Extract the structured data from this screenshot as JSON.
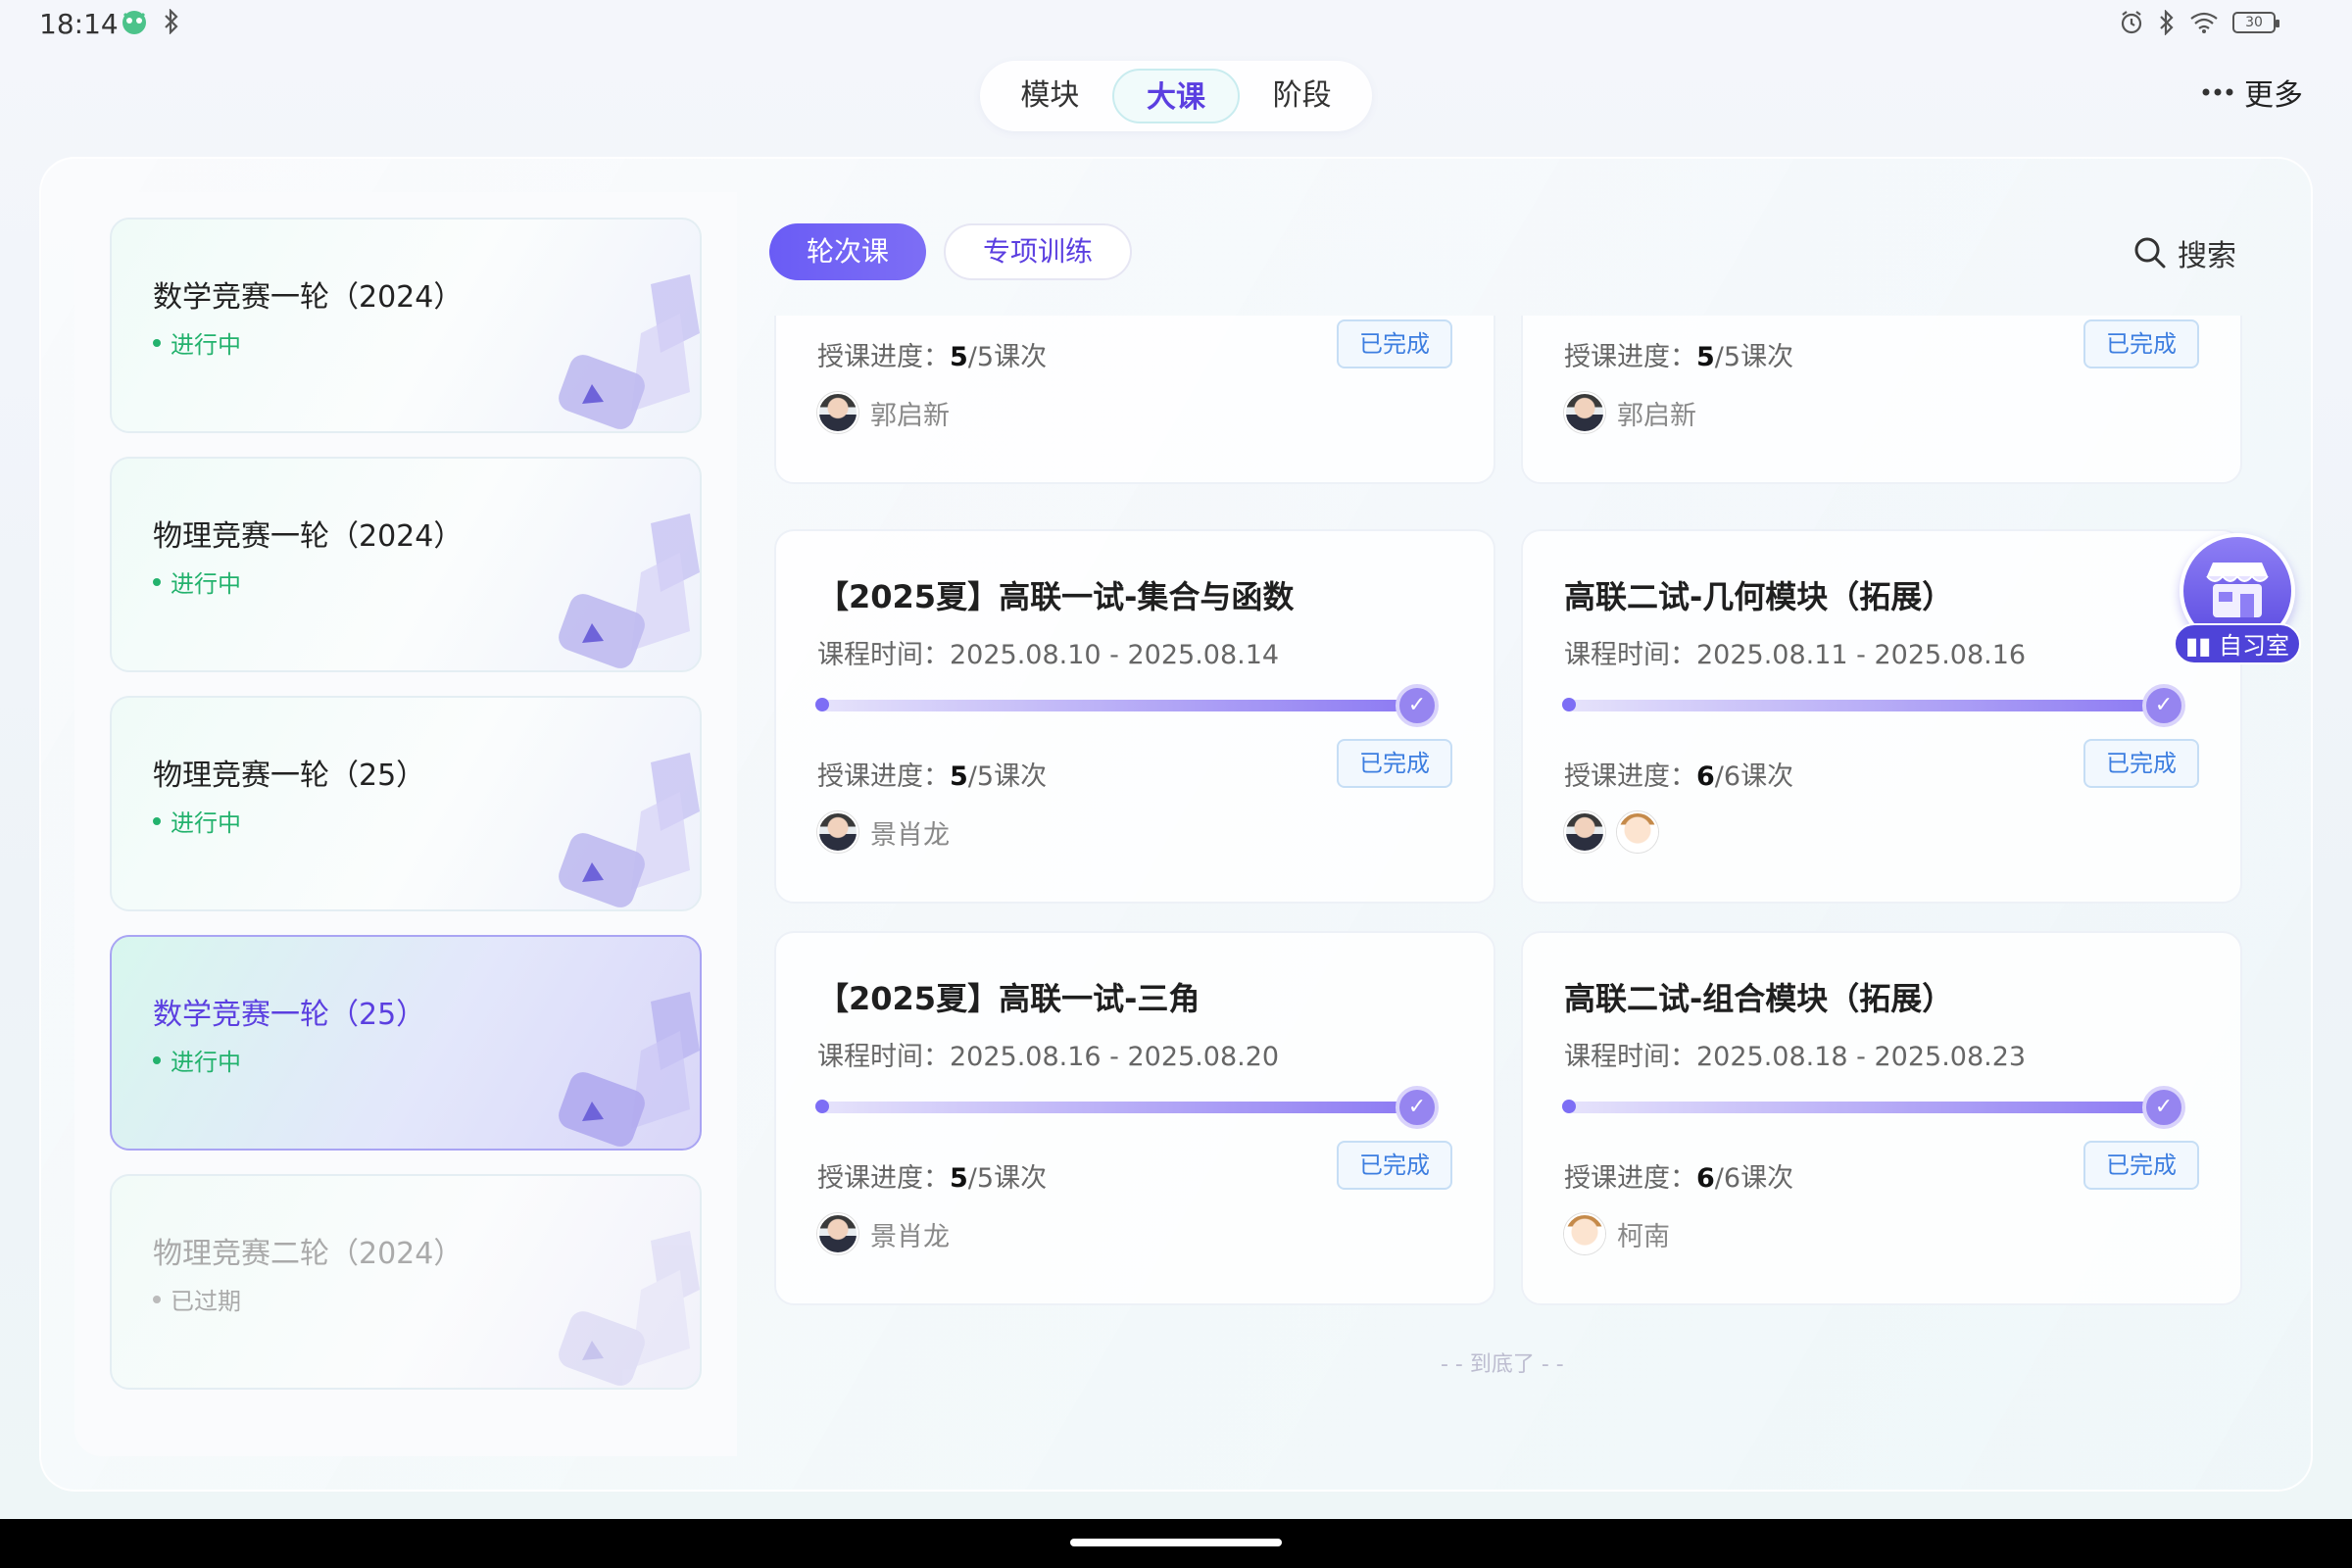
{
  "status_bar": {
    "time": "18:14",
    "battery": "30"
  },
  "top_tabs": [
    {
      "label": "模块",
      "active": false
    },
    {
      "label": "大课",
      "active": true
    },
    {
      "label": "阶段",
      "active": false
    }
  ],
  "more_label": "更多",
  "courses": [
    {
      "title": "数学竞赛一轮（2024）",
      "status": "进行中"
    },
    {
      "title": "物理竞赛一轮（2024）",
      "status": "进行中"
    },
    {
      "title": "物理竞赛一轮（25）",
      "status": "进行中"
    },
    {
      "title": "数学竞赛一轮（25）",
      "status": "进行中",
      "active": true
    },
    {
      "title": "物理竞赛二轮（2024）",
      "status": "已过期",
      "expired": true
    }
  ],
  "sub_tabs": [
    {
      "label": "轮次课",
      "active": true
    },
    {
      "label": "专项训练",
      "active": false
    }
  ],
  "search_label": "搜索",
  "progress_label": "授课进度：",
  "time_label": "课程时间：",
  "lessons": [
    {
      "title": "",
      "time": "",
      "done": "5",
      "total": "/5课次",
      "status": "已完成",
      "teachers": [
        "郭启新"
      ]
    },
    {
      "title": "",
      "time": "",
      "done": "5",
      "total": "/5课次",
      "status": "已完成",
      "teachers": [
        "郭启新"
      ]
    },
    {
      "title": "【2025夏】高联一试-集合与函数",
      "time": "2025.08.10 - 2025.08.14",
      "done": "5",
      "total": "/5课次",
      "status": "已完成",
      "teachers": [
        "景肖龙"
      ]
    },
    {
      "title": "高联二试-几何模块（拓展）",
      "time": "2025.08.11 - 2025.08.16",
      "done": "6",
      "total": "/6课次",
      "status": "已完成",
      "teachers": []
    },
    {
      "title": "【2025夏】高联一试-三角",
      "time": "2025.08.16 - 2025.08.20",
      "done": "5",
      "total": "/5课次",
      "status": "已完成",
      "teachers": [
        "景肖龙"
      ]
    },
    {
      "title": "高联二试-组合模块（拓展）",
      "time": "2025.08.18 - 2025.08.23",
      "done": "6",
      "total": "/6课次",
      "status": "已完成",
      "teachers": [
        "柯南"
      ]
    }
  ],
  "end_text": "- - 到底了 - -",
  "study_room": "自习室",
  "colors": {
    "accent": "#5b3fe0",
    "active_green": "#23b26d",
    "done_blue": "#3d7ee0"
  }
}
